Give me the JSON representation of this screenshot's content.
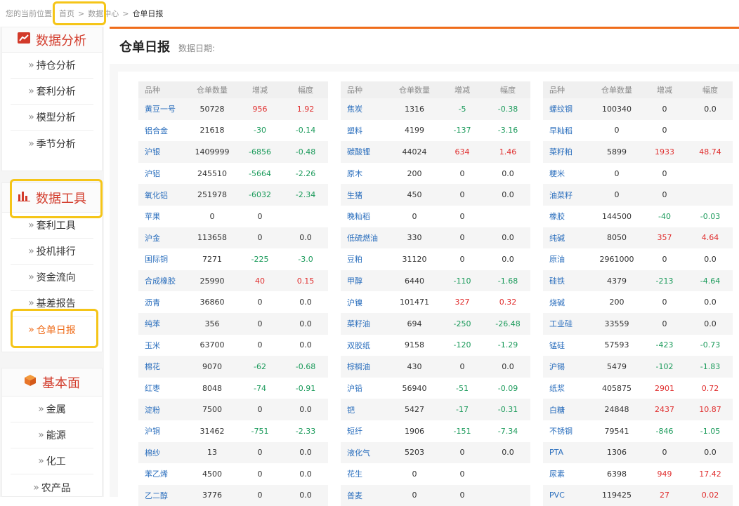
{
  "breadcrumb": {
    "prefix": "您的当前位置",
    "home": "首页",
    "sep1": ">",
    "center": "数据中心",
    "sep2": ">",
    "current": "仓单日报"
  },
  "sidebar": {
    "sections": [
      {
        "title": "数据分析",
        "items": [
          "持仓分析",
          "套利分析",
          "模型分析",
          "季节分析"
        ]
      },
      {
        "title": "数据工具",
        "items": [
          "套利工具",
          "投机排行",
          "资金流向",
          "基差报告",
          "仓单日报"
        ]
      },
      {
        "title": "基本面",
        "items": [
          "金属",
          "能源",
          "化工",
          "农产品"
        ]
      }
    ],
    "arrow": "»"
  },
  "page": {
    "title": "仓单日报",
    "date_label": "数据日期:"
  },
  "table": {
    "headers": [
      "品种",
      "仓单数量",
      "增减",
      "幅度"
    ],
    "columns": [
      [
        [
          "黄豆一号",
          "50728",
          "956",
          "1.92"
        ],
        [
          "铝合金",
          "21618",
          "-30",
          "-0.14"
        ],
        [
          "沪银",
          "1409999",
          "-6856",
          "-0.48"
        ],
        [
          "沪铝",
          "245510",
          "-5664",
          "-2.26"
        ],
        [
          "氧化铝",
          "251978",
          "-6032",
          "-2.34"
        ],
        [
          "苹果",
          "0",
          "0",
          ""
        ],
        [
          "沪金",
          "113658",
          "0",
          "0.0"
        ],
        [
          "国际铜",
          "7271",
          "-225",
          "-3.0"
        ],
        [
          "合成橡胶",
          "25990",
          "40",
          "0.15"
        ],
        [
          "沥青",
          "36860",
          "0",
          "0.0"
        ],
        [
          "纯苯",
          "356",
          "0",
          "0.0"
        ],
        [
          "玉米",
          "63700",
          "0",
          "0.0"
        ],
        [
          "棉花",
          "9070",
          "-62",
          "-0.68"
        ],
        [
          "红枣",
          "8048",
          "-74",
          "-0.91"
        ],
        [
          "淀粉",
          "7500",
          "0",
          "0.0"
        ],
        [
          "沪铜",
          "31462",
          "-751",
          "-2.33"
        ],
        [
          "棉纱",
          "13",
          "0",
          "0.0"
        ],
        [
          "苯乙烯",
          "4500",
          "0",
          "0.0"
        ],
        [
          "乙二醇",
          "3776",
          "0",
          "0.0"
        ]
      ],
      [
        [
          "焦炭",
          "1316",
          "-5",
          "-0.38"
        ],
        [
          "塑料",
          "4199",
          "-137",
          "-3.16"
        ],
        [
          "碳酸锂",
          "44024",
          "634",
          "1.46"
        ],
        [
          "原木",
          "200",
          "0",
          "0.0"
        ],
        [
          "生猪",
          "450",
          "0",
          "0.0"
        ],
        [
          "晚籼稻",
          "0",
          "0",
          ""
        ],
        [
          "低硫燃油",
          "330",
          "0",
          "0.0"
        ],
        [
          "豆粕",
          "31120",
          "0",
          "0.0"
        ],
        [
          "甲醇",
          "6440",
          "-110",
          "-1.68"
        ],
        [
          "沪镍",
          "101471",
          "327",
          "0.32"
        ],
        [
          "菜籽油",
          "694",
          "-250",
          "-26.48"
        ],
        [
          "双胶纸",
          "9158",
          "-120",
          "-1.29"
        ],
        [
          "棕榈油",
          "430",
          "0",
          "0.0"
        ],
        [
          "沪铅",
          "56940",
          "-51",
          "-0.09"
        ],
        [
          "钯",
          "5427",
          "-17",
          "-0.31"
        ],
        [
          "短纤",
          "1906",
          "-151",
          "-7.34"
        ],
        [
          "液化气",
          "5203",
          "0",
          "0.0"
        ],
        [
          "花生",
          "0",
          "0",
          ""
        ],
        [
          "普麦",
          "0",
          "0",
          ""
        ]
      ],
      [
        [
          "螺纹钢",
          "100340",
          "0",
          "0.0"
        ],
        [
          "早籼稻",
          "0",
          "0",
          ""
        ],
        [
          "菜籽粕",
          "5899",
          "1933",
          "48.74"
        ],
        [
          "粳米",
          "0",
          "0",
          ""
        ],
        [
          "油菜籽",
          "0",
          "0",
          ""
        ],
        [
          "橡胶",
          "144500",
          "-40",
          "-0.03"
        ],
        [
          "纯碱",
          "8050",
          "357",
          "4.64"
        ],
        [
          "原油",
          "2961000",
          "0",
          "0.0"
        ],
        [
          "硅铁",
          "4379",
          "-213",
          "-4.64"
        ],
        [
          "烧碱",
          "200",
          "0",
          "0.0"
        ],
        [
          "工业硅",
          "33559",
          "0",
          "0.0"
        ],
        [
          "锰硅",
          "57593",
          "-423",
          "-0.73"
        ],
        [
          "沪锡",
          "5479",
          "-102",
          "-1.83"
        ],
        [
          "纸浆",
          "405875",
          "2901",
          "0.72"
        ],
        [
          "白糖",
          "24848",
          "2437",
          "10.87"
        ],
        [
          "不锈钢",
          "79541",
          "-846",
          "-1.05"
        ],
        [
          "PTA",
          "1306",
          "0",
          "0.0"
        ],
        [
          "尿素",
          "6398",
          "949",
          "17.42"
        ],
        [
          "PVC",
          "119425",
          "27",
          "0.02"
        ]
      ]
    ]
  },
  "colors": {
    "accent": "#ef6c1a",
    "brand_red": "#d23a2a",
    "up": "#e02f2f",
    "down": "#1a9a5a",
    "link": "#2a6ebd",
    "highlight": "#f5c518"
  }
}
